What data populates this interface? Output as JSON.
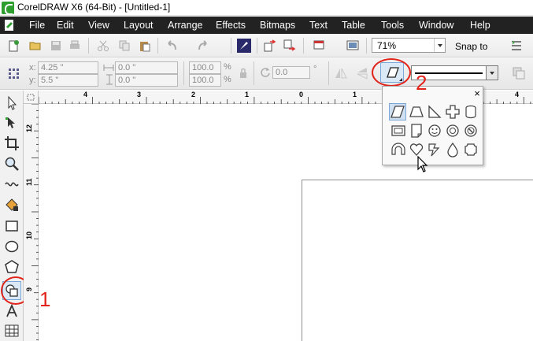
{
  "window": {
    "title": "CorelDRAW X6 (64-Bit) - [Untitled-1]"
  },
  "menu": {
    "items": [
      "File",
      "Edit",
      "View",
      "Layout",
      "Arrange",
      "Effects",
      "Bitmaps",
      "Text",
      "Table",
      "Tools",
      "Window",
      "Help"
    ]
  },
  "standard_toolbar": {
    "zoom_value": "71%",
    "snap_to_label": "Snap to"
  },
  "property_bar": {
    "x_label": "x:",
    "x_value": "4.25 \"",
    "y_label": "y:",
    "y_value": "5.5 \"",
    "width_value": "0.0 \"",
    "height_value": "0.0 \"",
    "scale_x": "100.0",
    "scale_y": "100.0",
    "percent_symbol": "%",
    "angle_value": "0.0",
    "degree_symbol": "°"
  },
  "rulers": {
    "horizontal_labels": [
      "4",
      "3",
      "2",
      "1",
      "0",
      "1",
      "2",
      "3",
      "4"
    ],
    "vertical_labels": [
      "12",
      "11",
      "10",
      "9"
    ]
  },
  "flyout": {
    "close_label": "×",
    "shapes": [
      "parallelogram-icon",
      "trapezoid-icon",
      "right-triangle-icon",
      "cross-icon",
      "cylinder-icon",
      "frame-icon",
      "folded-corner-icon",
      "smiley-icon",
      "donut-icon",
      "no-symbol-icon",
      "arch-icon",
      "heart-icon",
      "lightning-icon",
      "drop-icon",
      "plaque-icon"
    ]
  },
  "annotations": {
    "label_1": "1",
    "label_2": "2"
  },
  "colors": {
    "menubar_bg": "#222222",
    "annotation_red": "#e2231a",
    "selection_blue": "#dbe8f6"
  }
}
